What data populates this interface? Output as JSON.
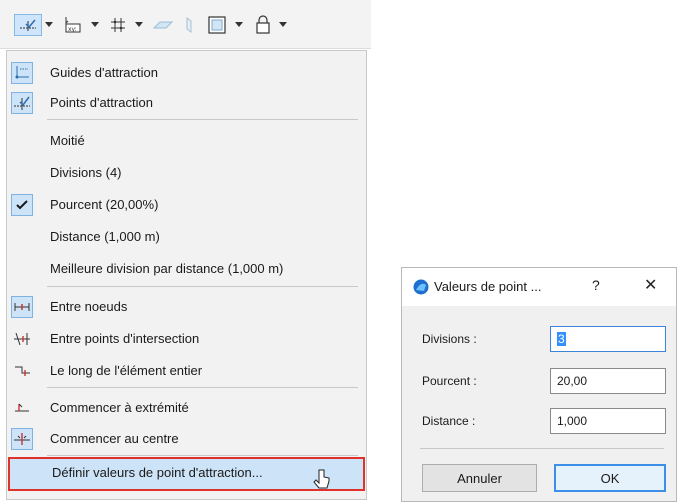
{
  "toolbar": {
    "icons": [
      "snap-points-icon",
      "dropdown-arrow-icon",
      "coordinate-input-icon",
      "dropdown-arrow-icon",
      "grid-snap-icon",
      "dropdown-arrow-icon",
      "surface-icon",
      "edge-icon",
      "rectangle-icon",
      "dropdown-arrow-icon",
      "lock-icon",
      "dropdown-arrow-icon"
    ]
  },
  "menu": {
    "items": [
      {
        "label": "Guides d'attraction",
        "icon": "guides-icon"
      },
      {
        "label": "Points d'attraction",
        "icon": "snap-points-icon"
      },
      {
        "label": "Moitié"
      },
      {
        "label": "Divisions (4)"
      },
      {
        "label": "Pourcent (20,00%)",
        "checked": true
      },
      {
        "label": "Distance (1,000 m)"
      },
      {
        "label": "Meilleure division par distance (1,000 m)"
      },
      {
        "label": "Entre noeuds",
        "icon": "between-nodes-icon"
      },
      {
        "label": "Entre points d'intersection",
        "icon": "intersection-icon"
      },
      {
        "label": "Le long de l'élément entier",
        "icon": "along-element-icon"
      },
      {
        "label": "Commencer à extrémité",
        "icon": "start-end-icon"
      },
      {
        "label": "Commencer au centre",
        "icon": "start-center-icon"
      },
      {
        "label": "Définir valeurs de point d'attraction...",
        "highlighted": true
      }
    ]
  },
  "dialog": {
    "title": "Valeurs de point ...",
    "help": "?",
    "close": "✕",
    "fields": [
      {
        "label": "Divisions :",
        "value": "3"
      },
      {
        "label": "Pourcent :",
        "value": "20,00"
      },
      {
        "label": "Distance :",
        "value": "1,000"
      }
    ],
    "cancel": "Annuler",
    "ok": "OK"
  },
  "colors": {
    "accent": "#3c8ee6",
    "highlight": "#cde3f7",
    "red_outline": "#e0312b"
  }
}
